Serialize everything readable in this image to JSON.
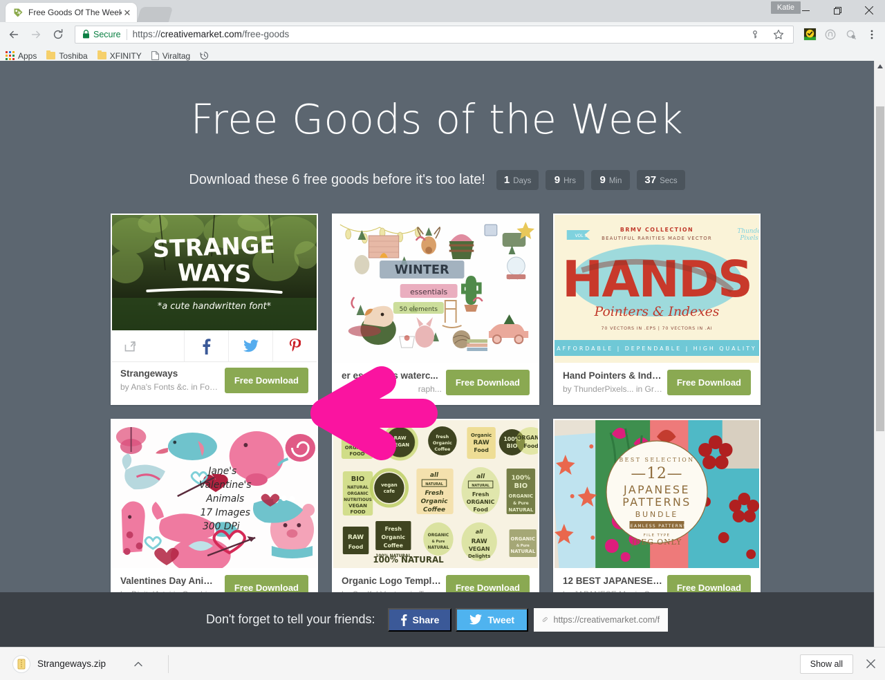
{
  "browser": {
    "tab": {
      "title": "Free Goods Of The Week",
      "favicon": "creative-market-tag-icon",
      "close": "✕"
    },
    "profile_badge": "Katie",
    "window_controls": {
      "minimize": "—",
      "maximize": "❐",
      "close": "✕"
    },
    "nav": {
      "back": "←",
      "forward": "→",
      "reload": "⟳"
    },
    "omnibox": {
      "security_label": "Secure",
      "url_scheme": "https://",
      "url_host": "creativemarket.com",
      "url_path": "/free-goods",
      "full_url": "https://creativemarket.com/free-goods"
    },
    "bookmarks": [
      {
        "label": "Apps",
        "icon": "apps-grid-icon"
      },
      {
        "label": "Toshiba",
        "icon": "folder-icon"
      },
      {
        "label": "XFINITY",
        "icon": "folder-icon"
      },
      {
        "label": "Viraltag",
        "icon": "page-icon"
      },
      {
        "label": "",
        "icon": "history-clock-icon"
      }
    ],
    "extensions": [
      {
        "name": "key-icon"
      },
      {
        "name": "bookmark-star-icon"
      },
      {
        "name": "wot-shield-icon"
      },
      {
        "name": "circle-extension-icon"
      },
      {
        "name": "magnifier-extension-icon"
      },
      {
        "name": "chrome-menu-icon"
      }
    ]
  },
  "page": {
    "hero_title": "Free Goods of the Week",
    "subtitle": "Download these 6 free goods before it's too late!",
    "countdown": [
      {
        "value": "1",
        "unit": "Days"
      },
      {
        "value": "9",
        "unit": "Hrs"
      },
      {
        "value": "9",
        "unit": "Min"
      },
      {
        "value": "37",
        "unit": "Secs"
      }
    ],
    "download_label": "Free Download",
    "share_icons": [
      {
        "name": "share-export-icon"
      },
      {
        "name": "facebook-icon"
      },
      {
        "name": "twitter-icon"
      },
      {
        "name": "pinterest-icon"
      }
    ],
    "cards": [
      {
        "title": "Strangeways",
        "by": "by Ana's Fonts &c. in Fonts",
        "button": "Free Download",
        "hovered": true,
        "art": "strangeways-handwritten-font-forest-photo"
      },
      {
        "title": "er essentials waterc...",
        "by": "raph...",
        "button": "Free Download",
        "hovered": false,
        "art": "winter-essentials-watercolor-clipart"
      },
      {
        "title": "Hand Pointers & Indexes...",
        "by": "by ThunderPixels... in Gra...",
        "button": "Free Download",
        "hovered": false,
        "art": "hands-pointers-indexes-vintage-poster"
      },
      {
        "title": "Valentines Day Animals ...",
        "by": "by DigitalArtsi in Graphics",
        "button": "Free Download",
        "hovered": false,
        "art": "valentines-day-animals-watercolor"
      },
      {
        "title": "Organic Logo Templates",
        "by": "by Soulful Vectors in Templ...",
        "button": "Free Download",
        "hovered": false,
        "art": "organic-logo-templates-badges"
      },
      {
        "title": "12 BEST JAPANESE PAT...",
        "by": "by JAPANESE M...  in Gra...",
        "button": "Free Download",
        "hovered": false,
        "art": "japanese-patterns-bundle-photo"
      }
    ],
    "footer": {
      "text": "Don't forget to tell your friends:",
      "facebook_label": "Share",
      "twitter_label": "Tweet",
      "link_value": "https://creativemarket.com/f"
    },
    "annotation": {
      "type": "left-arrow",
      "color": "#fa14a0"
    }
  },
  "downloads": {
    "item_name": "Strangeways.zip",
    "item_icon": "zip-file-icon",
    "caret": "⌃",
    "show_all": "Show all",
    "close": "✕"
  },
  "colors": {
    "page_bg": "#5c6670",
    "footer_bg": "#3b4046",
    "button_green": "#8aa952",
    "countdown_bg": "#4b545c",
    "facebook": "#3b5998",
    "twitter": "#4fb3ef",
    "pinterest": "#cb2027",
    "arrow_magenta": "#fa14a0",
    "secure_green": "#0b8043"
  }
}
